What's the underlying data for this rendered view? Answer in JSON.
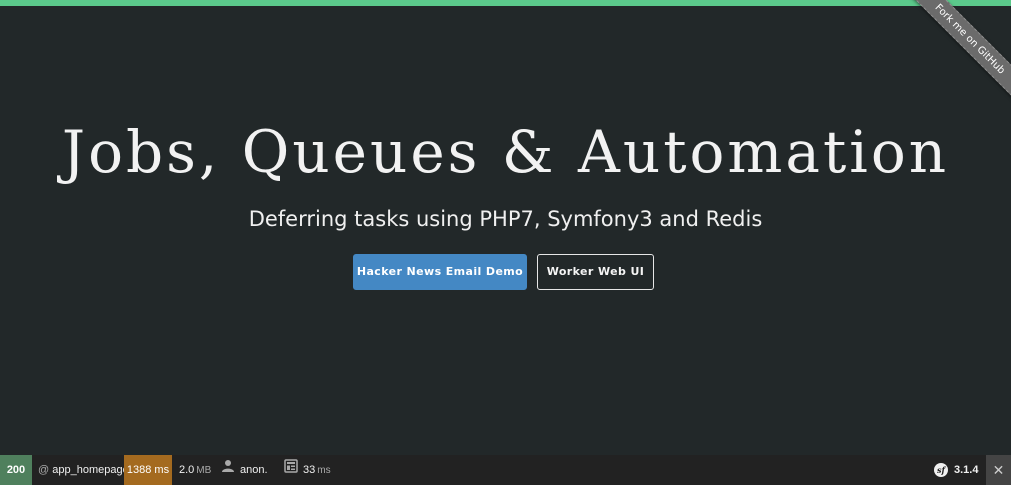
{
  "hero": {
    "title": "Jobs, Queues & Automation",
    "subtitle": "Deferring tasks using PHP7, Symfony3 and Redis",
    "primary_button": "Hacker News Email Demo",
    "secondary_button": "Worker Web UI"
  },
  "ribbon": {
    "label": "Fork me on GitHub"
  },
  "toolbar": {
    "status_code": "200",
    "route_prefix": "@",
    "route": "app_homepage",
    "time": "1388 ms",
    "memory_value": "2.0",
    "memory_unit": "MB",
    "user": "anon.",
    "twig_value": "33",
    "twig_unit": "ms",
    "symfony_logo_text": "sf",
    "version": "3.1.4",
    "close_symbol": "✕"
  },
  "colors": {
    "background": "#222829",
    "top_accent": "#5bc98b",
    "primary_button": "#4488c4",
    "status_ok": "#4f805d",
    "time_warning": "#a46a1f",
    "ribbon": "#6b6b6b"
  },
  "icons": {
    "user": "user-icon",
    "twig": "template-icon",
    "symfony": "symfony-logo-icon",
    "close": "close-icon"
  }
}
